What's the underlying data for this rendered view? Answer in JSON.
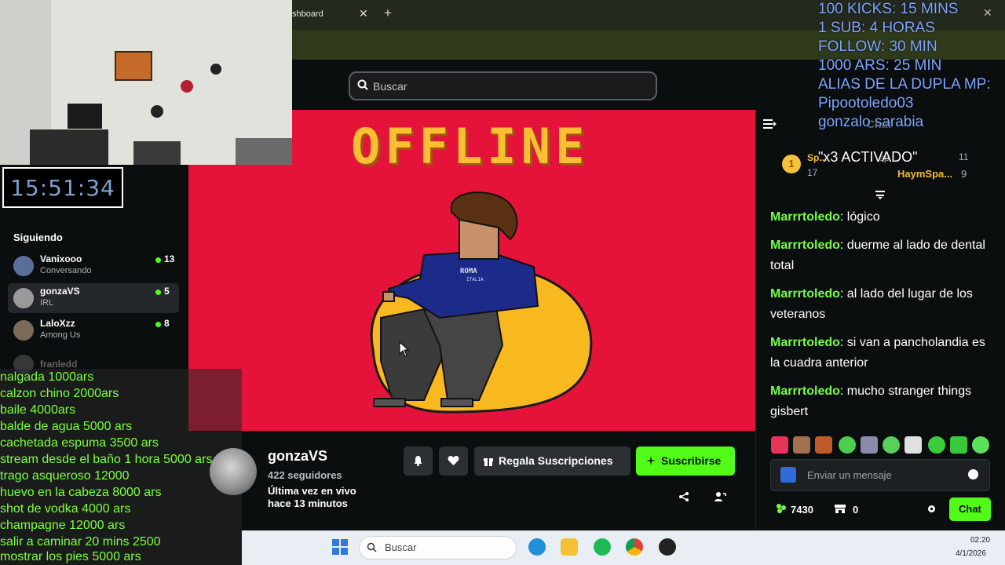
{
  "browser": {
    "tab_title": "shboard",
    "tab_close": "✕",
    "new_tab": "+",
    "window_close": "✕"
  },
  "header": {
    "search_placeholder": "Buscar"
  },
  "clock": {
    "time": "15:51:34"
  },
  "sidebar": {
    "following_title": "Siguiendo",
    "items": [
      {
        "name": "Vanixooo",
        "category": "Conversando",
        "viewers": "13",
        "live": true
      },
      {
        "name": "gonzaVS",
        "category": "IRL",
        "viewers": "5",
        "live": true,
        "active": true
      },
      {
        "name": "LaloXzz",
        "category": "Among Us",
        "viewers": "8",
        "live": true
      }
    ],
    "offline_item": "franledd"
  },
  "price_list": [
    "nalgada 1000ars",
    "calzon chino 2000ars",
    "baile 4000ars",
    "balde de agua 5000 ars",
    "cachetada espuma 3500 ars",
    "stream desde el baño 1 hora 5000 ars",
    "trago asqueroso 12000",
    "huevo en la cabeza 8000 ars",
    "shot de vodka 4000 ars",
    "champagne 12000 ars",
    "salir a caminar 20 mins 2500",
    "mostrar los pies 5000 ars"
  ],
  "overlay": {
    "lines": [
      "100 KICKS: 15 MINS",
      "1 SUB: 4 HORAS",
      "FOLLOW: 30 MIN",
      "1000 ARS: 25 MIN",
      "ALIAS DE LA DUPLA MP:",
      "Pipootoledo03",
      "gonzalo sarabia"
    ],
    "status": "\"x3 ACTIVADO\""
  },
  "player": {
    "offline_text": "OFFLINE",
    "hoodie_text": "ROMA",
    "hoodie_sub": "ITALIA"
  },
  "channel": {
    "name": "gonzaVS",
    "followers": "422 seguidores",
    "last_live_1": "Última vez en vivo",
    "last_live_2": "hace 13 minutos",
    "gift_label": "Regala Suscripciones",
    "subscribe_label": "Suscribirse"
  },
  "chat": {
    "header": "Chat",
    "leaderboard": {
      "rank_badge": "1",
      "first_name": "Sp...",
      "first_count": "17",
      "right_name": "sp...",
      "right_count": "11",
      "second_name": "HaymSpa...",
      "second_count": "9"
    },
    "messages": [
      {
        "user": "Marrrtoledo",
        "text": ": lógico"
      },
      {
        "user": "Marrrtoledo",
        "text": ": duerme al lado de dental total"
      },
      {
        "user": "Marrrtoledo",
        "text": ": al lado del lugar de los veteranos"
      },
      {
        "user": "Marrrtoledo",
        "text": ": si van a pancholandia es la cuadra anterior"
      },
      {
        "user": "Marrrtoledo",
        "text": ": mucho stranger things gisbert"
      }
    ],
    "input_placeholder": "Enviar un mensaje",
    "points": "7430",
    "store_count": "0",
    "send_label": "Chat"
  },
  "taskbar": {
    "search_text": "Buscar",
    "time": "02:20",
    "date": "4/1/2026"
  },
  "colors": {
    "kick_green": "#53fc18",
    "banner_red": "#e5133a",
    "offline_yellow": "#fcbf34",
    "chat_user": "#75fd46",
    "overlay_blue": "#7ea6ff"
  }
}
